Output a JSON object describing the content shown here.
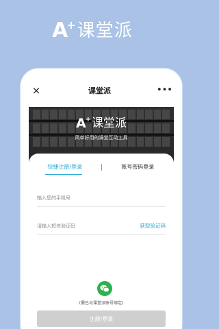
{
  "brand": {
    "mark": "A",
    "plus": "+",
    "name": "课堂派"
  },
  "topbar": {
    "close_icon": "×",
    "title": "课堂派",
    "more_icon": "•••"
  },
  "hero": {
    "logo_mark": "A",
    "logo_plus": "+",
    "logo_name": "课堂派",
    "tagline": "简单好用的课堂互动工具"
  },
  "tabs": [
    {
      "label": "快捷注册/登录",
      "active": true
    },
    {
      "label": "账号密码登录",
      "active": false
    }
  ],
  "form": {
    "phone_placeholder": "输入您的手机号",
    "code_placeholder": "请输入短信验证码",
    "get_code_label": "获取验证码",
    "submit_label": "注册/登录"
  },
  "wechat": {
    "icon": "wechat-icon",
    "note": "(需已与课堂派账号绑定)"
  },
  "colors": {
    "accent": "#27a9d6",
    "background": "#a9c2e6",
    "wechat": "#2fb14e",
    "button_disabled": "#cfcfcf"
  }
}
